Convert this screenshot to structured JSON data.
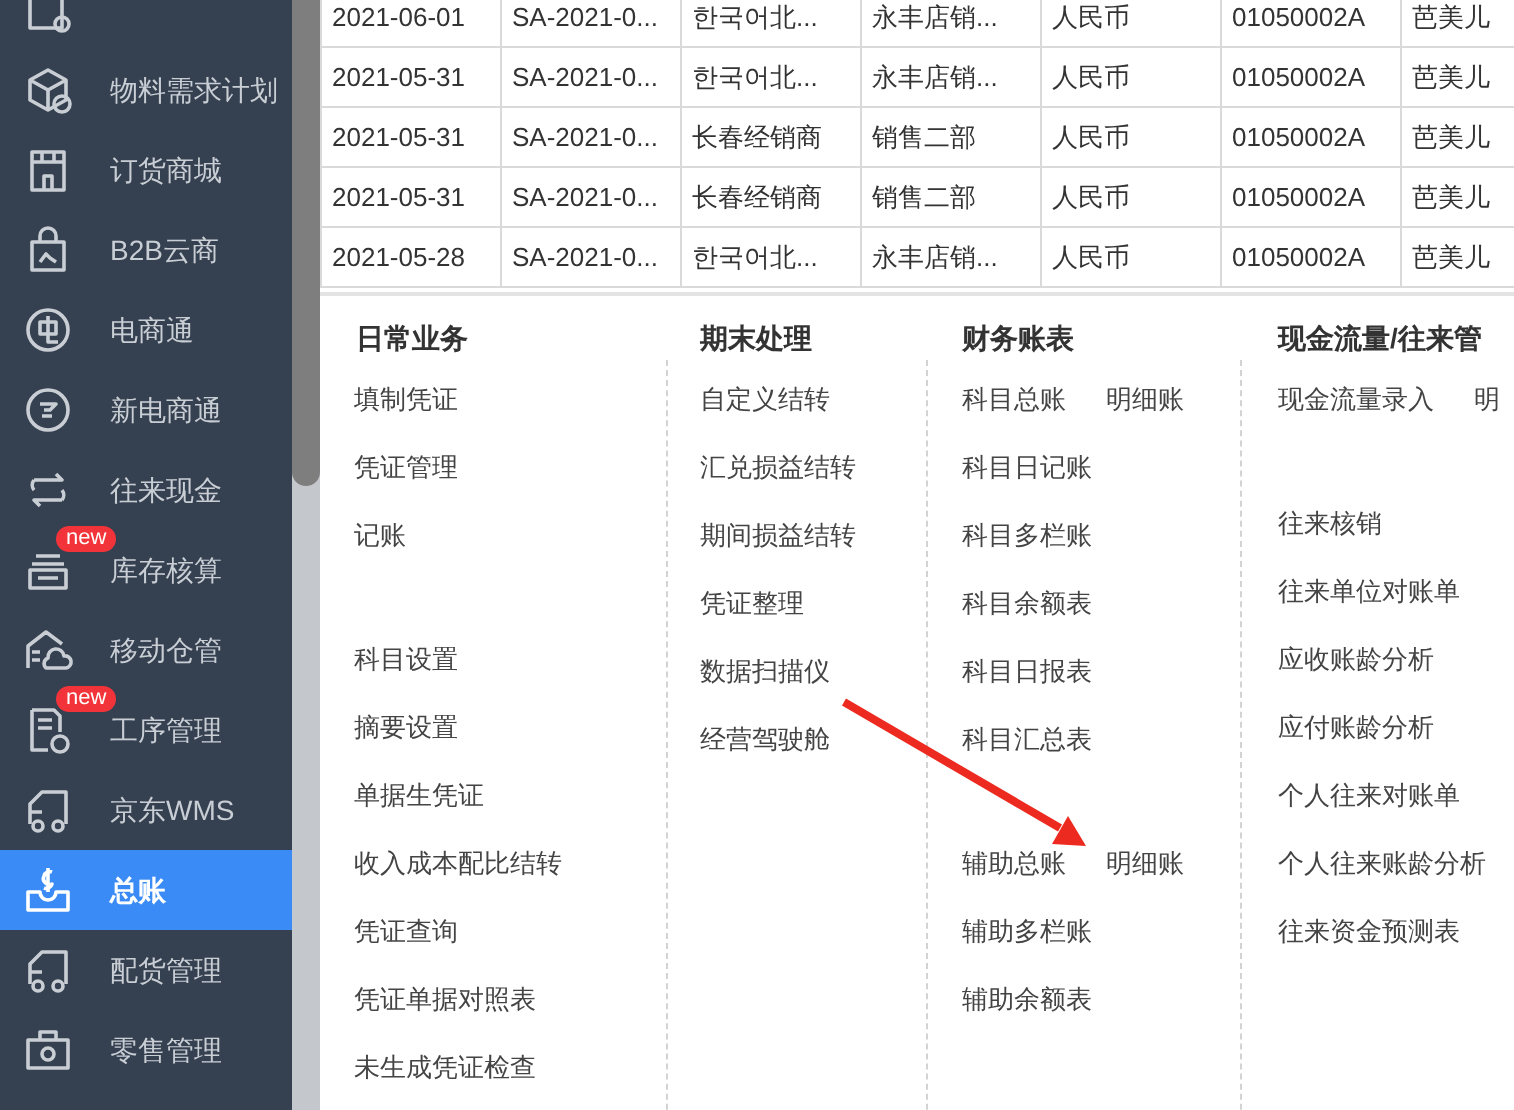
{
  "sidebar": {
    "items": [
      {
        "label": "物料需求计划",
        "selected": false
      },
      {
        "label": "订货商城",
        "selected": false
      },
      {
        "label": "B2B云商",
        "selected": false
      },
      {
        "label": "电商通",
        "selected": false
      },
      {
        "label": "新电商通",
        "selected": false
      },
      {
        "label": "往来现金",
        "selected": false
      },
      {
        "label": "库存核算",
        "selected": false,
        "badge": "new"
      },
      {
        "label": "移动仓管",
        "selected": false
      },
      {
        "label": "工序管理",
        "selected": false,
        "badge": "new"
      },
      {
        "label": "京东WMS",
        "selected": false
      },
      {
        "label": "总账",
        "selected": true
      },
      {
        "label": "配货管理",
        "selected": false
      },
      {
        "label": "零售管理",
        "selected": false
      }
    ]
  },
  "table": {
    "rows": [
      [
        "2021-06-01",
        "SA-2021-0...",
        "한국어北...",
        "永丰店销...",
        "人民币",
        "01050002A",
        "芭美儿"
      ],
      [
        "2021-05-31",
        "SA-2021-0...",
        "한국어北...",
        "永丰店销...",
        "人民币",
        "01050002A",
        "芭美儿"
      ],
      [
        "2021-05-31",
        "SA-2021-0...",
        "长春经销商",
        "销售二部",
        "人民币",
        "01050002A",
        "芭美儿"
      ],
      [
        "2021-05-31",
        "SA-2021-0...",
        "长春经销商",
        "销售二部",
        "人民币",
        "01050002A",
        "芭美儿"
      ],
      [
        "2021-05-28",
        "SA-2021-0...",
        "한국어北...",
        "永丰店销...",
        "人民币",
        "01050002A",
        "芭美儿"
      ]
    ]
  },
  "menu": {
    "columns": [
      {
        "title": "日常业务",
        "groups": [
          [
            [
              "填制凭证"
            ],
            [
              "凭证管理"
            ],
            [
              "记账"
            ]
          ],
          [
            [
              "科目设置"
            ],
            [
              "摘要设置"
            ],
            [
              "单据生凭证"
            ],
            [
              "收入成本配比结转"
            ],
            [
              "凭证查询"
            ],
            [
              "凭证单据对照表"
            ],
            [
              "未生成凭证检查"
            ]
          ]
        ]
      },
      {
        "title": "期末处理",
        "groups": [
          [
            [
              "自定义结转"
            ],
            [
              "汇兑损益结转"
            ],
            [
              "期间损益结转"
            ],
            [
              "凭证整理"
            ],
            [
              "数据扫描仪"
            ],
            [
              "经营驾驶舱"
            ]
          ]
        ]
      },
      {
        "title": "财务账表",
        "groups": [
          [
            [
              "科目总账",
              "明细账"
            ],
            [
              "科目日记账"
            ],
            [
              "科目多栏账"
            ],
            [
              "科目余额表"
            ],
            [
              "科目日报表"
            ],
            [
              "科目汇总表"
            ]
          ],
          [
            [
              "辅助总账",
              "明细账"
            ],
            [
              "辅助多栏账"
            ],
            [
              "辅助余额表"
            ]
          ]
        ]
      },
      {
        "title": "现金流量/往来管",
        "groups": [
          [
            [
              "现金流量录入",
              "明"
            ]
          ],
          [
            [
              "往来核销"
            ],
            [
              "往来单位对账单"
            ],
            [
              "应收账龄分析"
            ],
            [
              "应付账龄分析"
            ],
            [
              "个人往来对账单"
            ],
            [
              "个人往来账龄分析"
            ],
            [
              "往来资金预测表"
            ]
          ]
        ]
      }
    ]
  }
}
